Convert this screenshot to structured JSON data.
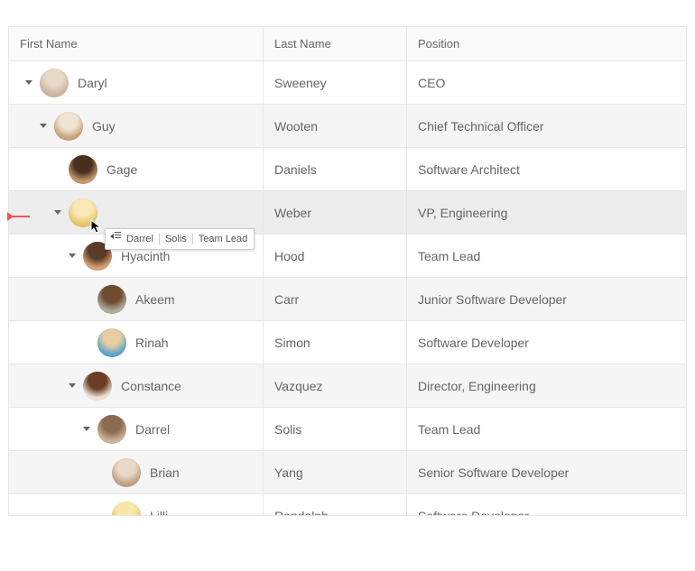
{
  "columns": {
    "first": "First Name",
    "last": "Last Name",
    "position": "Position"
  },
  "rows": [
    {
      "level": 0,
      "expanded": true,
      "first": "Daryl",
      "last": "Sweeney",
      "position": "CEO",
      "alt": false,
      "avatarA": "#e8d9c8",
      "avatarB": "#c9b59e"
    },
    {
      "level": 1,
      "expanded": true,
      "first": "Guy",
      "last": "Wooten",
      "position": "Chief Technical Officer",
      "alt": true,
      "avatarA": "#f0e4d2",
      "avatarB": "#c7a27c"
    },
    {
      "level": 2,
      "expanded": false,
      "first": "Gage",
      "last": "Daniels",
      "position": "Software Architect",
      "alt": false,
      "avatarA": "#4a2e1f",
      "avatarB": "#c59a6d",
      "leaf": true
    },
    {
      "level": 2,
      "expanded": true,
      "first": "",
      "last": "Weber",
      "position": "VP, Engineering",
      "alt": true,
      "dragOver": true,
      "avatarA": "#f9e9b8",
      "avatarB": "#e8c46a"
    },
    {
      "level": 3,
      "expanded": true,
      "first": "Hyacinth",
      "last": "Hood",
      "position": "Team Lead",
      "alt": false,
      "avatarA": "#5a3a28",
      "avatarB": "#d7a274"
    },
    {
      "level": 4,
      "expanded": false,
      "first": "Akeem",
      "last": "Carr",
      "position": "Junior Software Developer",
      "alt": true,
      "avatarA": "#6e4a2f",
      "avatarB": "#aeae9f",
      "leaf": true
    },
    {
      "level": 4,
      "expanded": false,
      "first": "Rinah",
      "last": "Simon",
      "position": "Software Developer",
      "alt": false,
      "avatarA": "#e7cda4",
      "avatarB": "#59a6c9",
      "leaf": true
    },
    {
      "level": 3,
      "expanded": true,
      "first": "Constance",
      "last": "Vazquez",
      "position": "Director, Engineering",
      "alt": true,
      "avatarA": "#6a3d24",
      "avatarB": "#efe2d7"
    },
    {
      "level": 4,
      "expanded": true,
      "first": "Darrel",
      "last": "Solis",
      "position": "Team Lead",
      "alt": false,
      "avatarA": "#8a6a50",
      "avatarB": "#cdb39a"
    },
    {
      "level": 5,
      "expanded": false,
      "first": "Brian",
      "last": "Yang",
      "position": "Senior Software Developer",
      "alt": true,
      "avatarA": "#e9d9c6",
      "avatarB": "#bfa084",
      "leaf": true
    },
    {
      "level": 5,
      "expanded": false,
      "first": "Lilli",
      "last": "Randolph",
      "position": "Software Developer",
      "alt": false,
      "avatarA": "#f7e7a8",
      "avatarB": "#e7c261",
      "leaf": true
    }
  ],
  "dragHint": {
    "first": "Darrel",
    "last": "Solis",
    "position": "Team Lead"
  }
}
